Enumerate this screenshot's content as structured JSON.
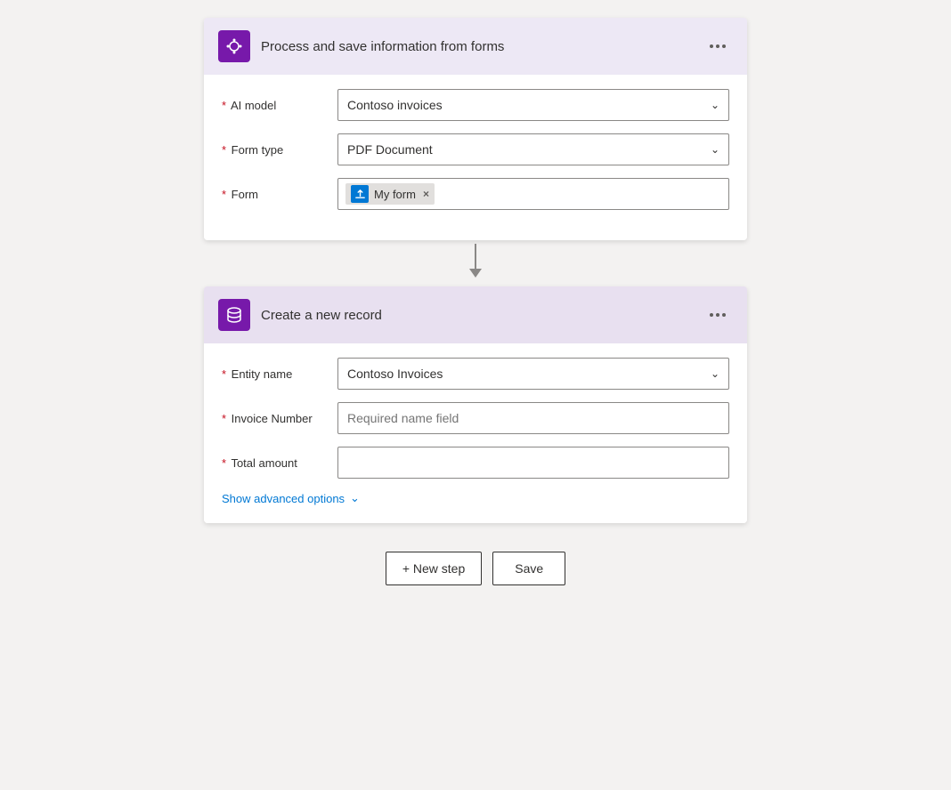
{
  "card1": {
    "title": "Process and save information from forms",
    "fields": {
      "ai_model_label": "* AI model",
      "ai_model_value": "Contoso invoices",
      "form_type_label": "* Form type",
      "form_type_value": "PDF Document",
      "form_label": "* Form",
      "form_tag": "My form"
    }
  },
  "card2": {
    "title": "Create a new record",
    "fields": {
      "entity_name_label": "* Entity name",
      "entity_name_value": "Contoso Invoices",
      "invoice_number_label": "* Invoice Number",
      "invoice_number_placeholder": "Required name field",
      "total_amount_label": "* Total amount"
    },
    "advanced_options_label": "Show advanced options"
  },
  "actions": {
    "new_step_label": "+ New step",
    "save_label": "Save"
  }
}
